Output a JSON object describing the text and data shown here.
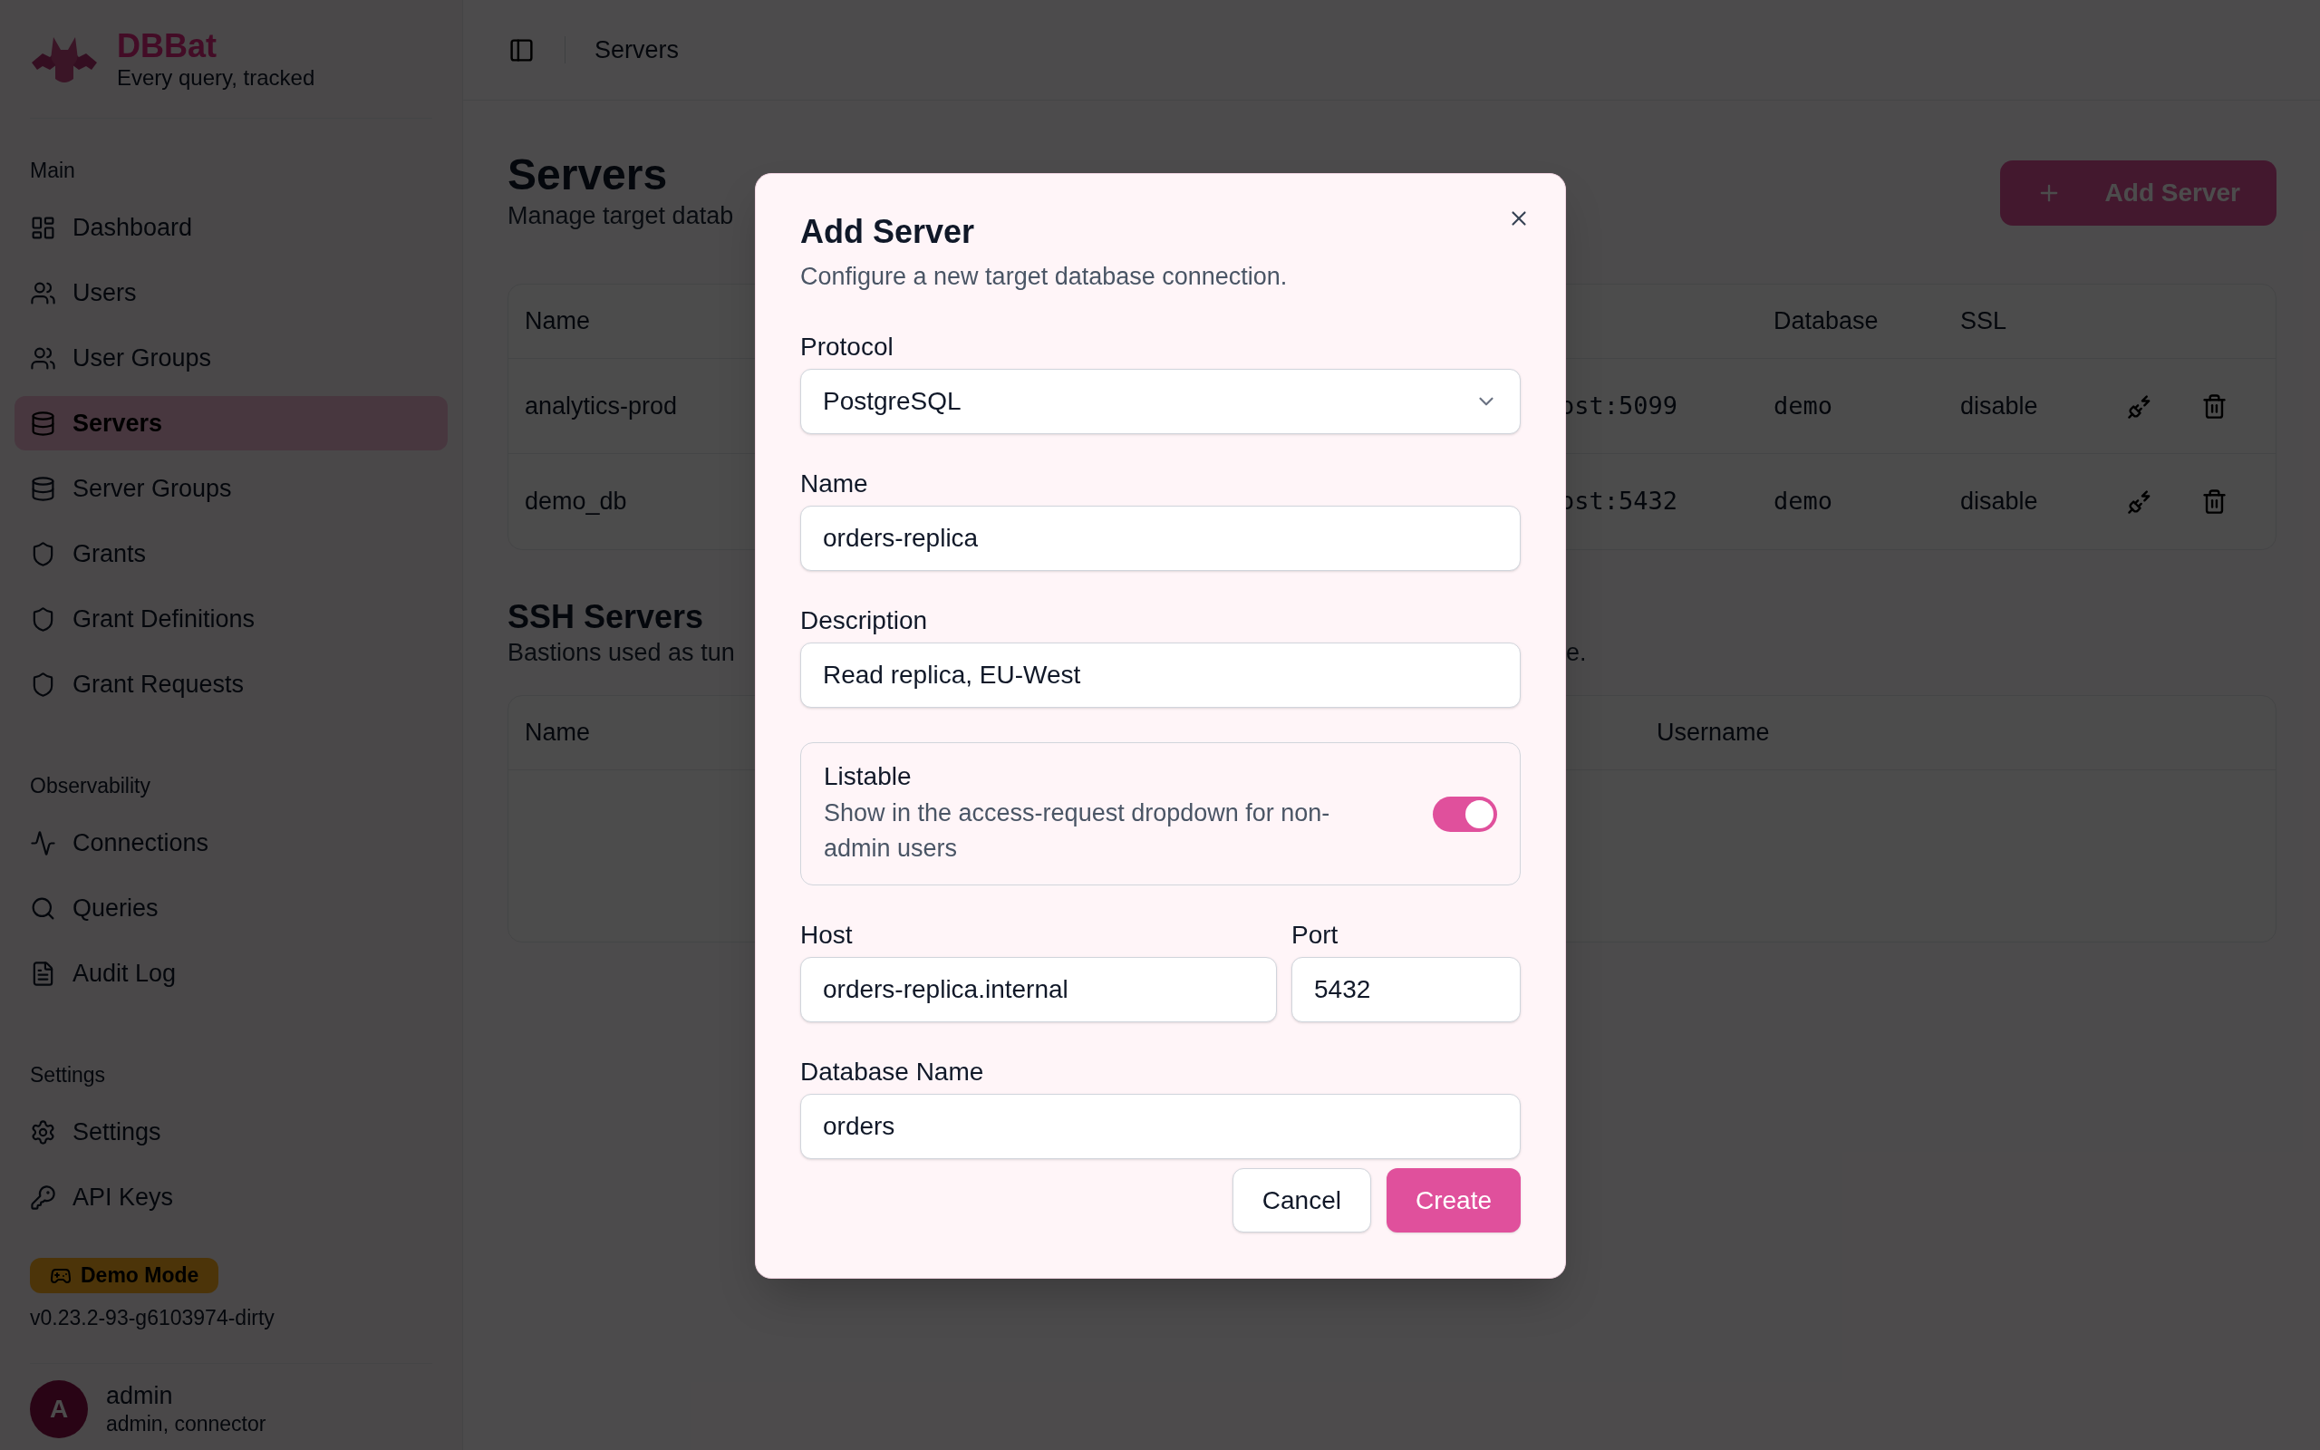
{
  "sidebar": {
    "brand": {
      "name": "DBBat",
      "tagline": "Every query, tracked"
    },
    "sections": [
      {
        "title": "Main",
        "items": [
          {
            "label": "Dashboard",
            "selected": false
          },
          {
            "label": "Users",
            "selected": false
          },
          {
            "label": "User Groups",
            "selected": false
          },
          {
            "label": "Servers",
            "selected": true
          },
          {
            "label": "Server Groups",
            "selected": false
          },
          {
            "label": "Grants",
            "selected": false
          },
          {
            "label": "Grant Definitions",
            "selected": false
          },
          {
            "label": "Grant Requests",
            "selected": false
          }
        ]
      },
      {
        "title": "Observability",
        "items": [
          {
            "label": "Connections",
            "selected": false
          },
          {
            "label": "Queries",
            "selected": false
          },
          {
            "label": "Audit Log",
            "selected": false
          }
        ]
      },
      {
        "title": "Settings",
        "items": [
          {
            "label": "Settings",
            "selected": false
          },
          {
            "label": "API Keys",
            "selected": false
          }
        ]
      }
    ],
    "demo_badge": "Demo Mode",
    "version": "v0.23.2-93-g6103974-dirty",
    "user": {
      "initial": "A",
      "name": "admin",
      "roles": "admin, connector"
    }
  },
  "header": {
    "breadcrumb": "Servers"
  },
  "page": {
    "title": "Servers",
    "subtitle": "Manage target datab",
    "add_button": "Add Server",
    "servers_table": {
      "columns": {
        "name": "Name",
        "database": "Database",
        "ssl": "SSL"
      },
      "rows": [
        {
          "name": "analytics-prod",
          "host": "ost:5099",
          "database": "demo",
          "ssl": "disable"
        },
        {
          "name": "demo_db",
          "host": "ost:5432",
          "database": "demo",
          "ssl": "disable"
        }
      ]
    },
    "ssh_title": "SSH Servers",
    "ssh_subtitle": "Bastions used as tun",
    "ssh_subtitle_tail": "e.",
    "ssh_table": {
      "columns": {
        "name": "Name",
        "username": "Username"
      }
    }
  },
  "modal": {
    "title": "Add Server",
    "description": "Configure a new target database connection.",
    "fields": [
      {
        "kind": "select",
        "label": "Protocol",
        "value": "PostgreSQL"
      },
      {
        "kind": "text",
        "label": "Name",
        "value": "orders-replica"
      },
      {
        "kind": "text",
        "label": "Description",
        "value": "Read replica, EU-West"
      },
      {
        "kind": "toggle",
        "label": "Listable",
        "description": "Show in the access-request dropdown for non-admin users",
        "on": true
      },
      {
        "kind": "pair",
        "fields": [
          {
            "label": "Host",
            "value": "orders-replica.internal"
          },
          {
            "label": "Port",
            "value": "5432"
          }
        ]
      },
      {
        "kind": "text",
        "label": "Database Name",
        "value": "orders"
      }
    ],
    "buttons": [
      {
        "label": "Cancel",
        "kind": "secondary"
      },
      {
        "label": "Create",
        "kind": "primary"
      }
    ]
  }
}
